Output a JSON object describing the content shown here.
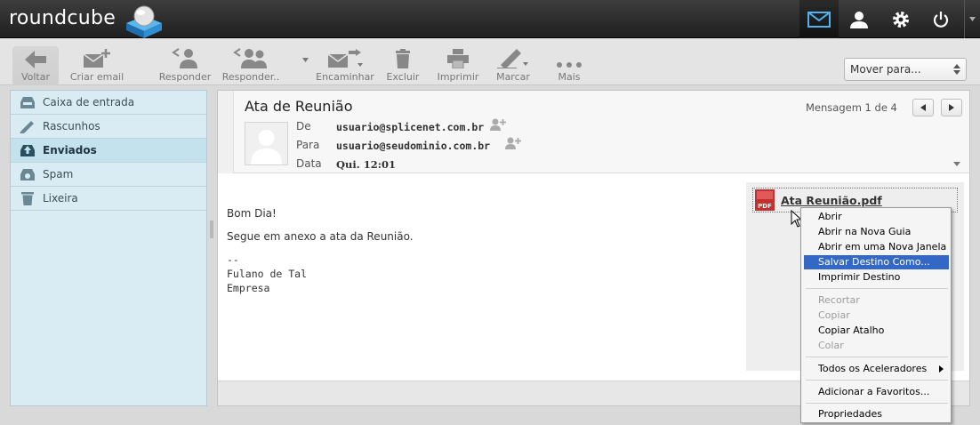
{
  "app": {
    "logo_text": "roundcube"
  },
  "topnav": {
    "icons": [
      "mail-icon",
      "user-icon",
      "gear-icon",
      "power-icon"
    ]
  },
  "toolbar": {
    "voltar": "Voltar",
    "criar_email": "Criar email",
    "responder": "Responder",
    "responder_todos": "Responder..",
    "encaminhar": "Encaminhar",
    "excluir": "Excluir",
    "imprimir": "Imprimir",
    "marcar": "Marcar",
    "mais": "Mais",
    "move_select": "Mover para..."
  },
  "sidebar": {
    "folders": [
      {
        "label": "Caixa de entrada",
        "icon": "inbox-icon"
      },
      {
        "label": "Rascunhos",
        "icon": "pencil-icon"
      },
      {
        "label": "Enviados",
        "icon": "sent-icon",
        "selected": true
      },
      {
        "label": "Spam",
        "icon": "spam-icon"
      },
      {
        "label": "Lixeira",
        "icon": "trash-icon"
      }
    ]
  },
  "message": {
    "subject": "Ata de Reunião",
    "counter": "Mensagem 1 de 4",
    "from_label": "De",
    "from": "usuario@splicenet.com.br",
    "to_label": "Para",
    "to": "usuario@seudominio.com.br",
    "date_label": "Data",
    "date": "Qui. 12:01",
    "body": {
      "greeting": "Bom Dia!",
      "line1": "Segue em anexo a ata da Reunião.",
      "signature": "--\nFulano de Tal\nEmpresa"
    },
    "attachment": {
      "name": "Ata Reunião.pdf",
      "icon_text": "PDF"
    }
  },
  "context_menu": {
    "items": {
      "abrir": "Abrir",
      "nova_guia": "Abrir na Nova Guia",
      "nova_janela": "Abrir em uma Nova Janela",
      "salvar_destino": "Salvar Destino Como...",
      "imprimir_destino": "Imprimir Destino",
      "recortar": "Recortar",
      "copiar": "Copiar",
      "copiar_atalho": "Copiar Atalho",
      "colar": "Colar",
      "aceleradores": "Todos os Aceleradores",
      "favoritos": "Adicionar a Favoritos...",
      "propriedades": "Propriedades"
    },
    "highlight_color": "#3468c6"
  },
  "colors": {
    "topbar": "#2b2b2b",
    "sidebar_bg": "#d9ecf3",
    "sidebar_selected": "#c4e2ee",
    "logo_cube": "#2f8fd1"
  }
}
